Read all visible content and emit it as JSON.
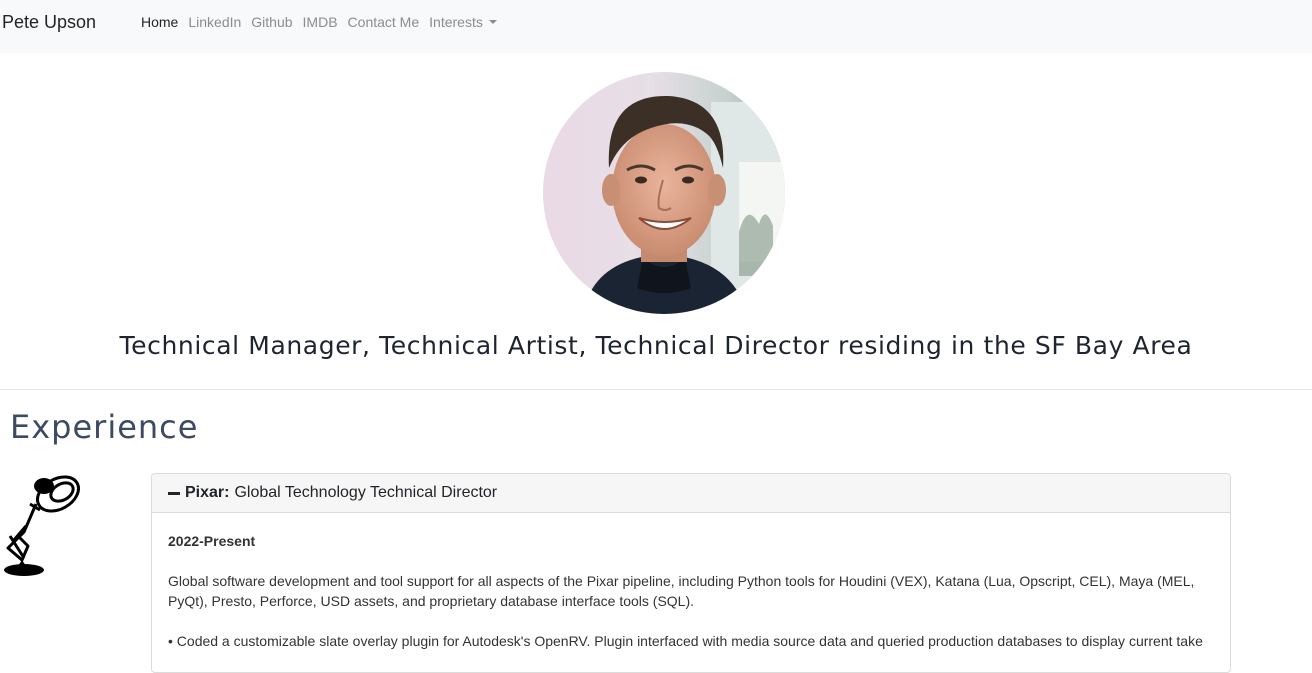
{
  "nav": {
    "brand": "Pete Upson",
    "links": [
      "Home",
      "LinkedIn",
      "Github",
      "IMDB",
      "Contact Me"
    ],
    "dropdown_label": "Interests"
  },
  "hero": {
    "tagline": "Technical Manager, Technical Artist, Technical Director residing in the SF Bay Area"
  },
  "experience": {
    "title": "Experience",
    "jobs": [
      {
        "company": "Pixar:",
        "role": "Global Technology Technical Director",
        "years": "2022-Present",
        "description": "Global software development and tool support for all aspects of the Pixar pipeline, including Python tools for Houdini (VEX), Katana (Lua, Opscript, CEL), Maya (MEL, PyQt), Presto, Perforce, USD assets, and proprietary database interface tools (SQL).",
        "bullet": "• Coded a customizable slate overlay plugin for Autodesk's OpenRV. Plugin interfaced with media source data and queried production databases to display current take"
      }
    ]
  },
  "colors": {
    "navbar_bg": "#f8f9fa",
    "section_title": "#3d4a63",
    "card_header_bg": "#f6f6f6"
  },
  "icons": {
    "collapse": "minus-icon",
    "company_logo": "pixar-lamp-icon"
  }
}
